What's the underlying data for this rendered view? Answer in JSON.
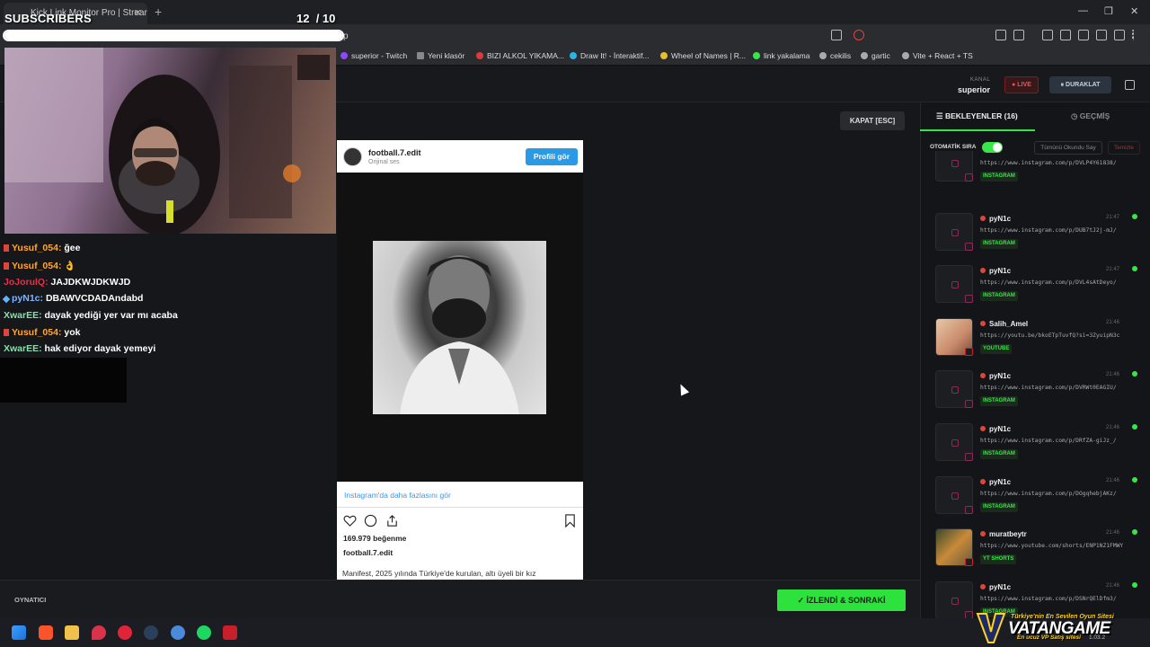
{
  "browser": {
    "tab_title": "Kick Link Monitor Pro | Stream",
    "tab_close": "✕",
    "new_tab": "+",
    "url": "p",
    "window_minimize": "—",
    "window_maximize": "❐",
    "window_close": "✕"
  },
  "bookmarks": [
    {
      "label": "superior - Twitch",
      "color": "#9146ff"
    },
    {
      "label": "Yeni klasör",
      "color": "#888888"
    },
    {
      "label": "BIZI ALKOL YIKAMA...",
      "color": "#e03b3b"
    },
    {
      "label": "Draw It! - İnteraktif...",
      "color": "#2bb3e6"
    },
    {
      "label": "Wheel of Names | R...",
      "color": "#e6c02b"
    },
    {
      "label": "link yakalama",
      "color": "#39e64a"
    },
    {
      "label": "cekilis",
      "color": "#aaaaaa"
    },
    {
      "label": "gartic",
      "color": "#aaaaaa"
    },
    {
      "label": "Vite + React + TS",
      "color": "#aaaaaa"
    }
  ],
  "overlay": {
    "subs_label": "SUBSCRIBERS",
    "subs_current": "12",
    "subs_goal": "/ 10",
    "subs_progress": 1.0
  },
  "header": {
    "kanal_label": "KANAL",
    "channel": "superior",
    "live": "● LIVE",
    "pause": "⏸ DURAKLAT"
  },
  "chat": [
    {
      "user": "Yusuf_054:",
      "msg": "ğee",
      "color": "#ffa733",
      "badge": "#e0443a"
    },
    {
      "user": "Yusuf_054:",
      "msg": "👌",
      "color": "#ffa733",
      "badge": "#e0443a"
    },
    {
      "user": "JoJorulQ:",
      "msg": "JAJDKWJDKWJD",
      "color": "#e0334a",
      "badge": ""
    },
    {
      "user": "pyN1c:",
      "msg": "DBAWVCDADAndabd",
      "color": "#7fb6ff",
      "badge": "#5fb6ff"
    },
    {
      "user": "XwarEE:",
      "msg": "dayak yediği yer var mı acaba",
      "color": "#8fdcb0",
      "badge": ""
    },
    {
      "user": "Yusuf_054:",
      "msg": "yok",
      "color": "#ffa733",
      "badge": "#e0443a"
    },
    {
      "user": "XwarEE:",
      "msg": "hak ediyor dayak yemeyi",
      "color": "#8fdcb0",
      "badge": ""
    }
  ],
  "blackbox_text": "",
  "center": {
    "close_button": "KAPAT [ESC]"
  },
  "instagram": {
    "username": "football.7.edit",
    "subtitle": "Orijinal ses",
    "profile_button": "Profili gör",
    "more_link": "Instagram'da daha fazlasını gör",
    "likes": "169.979 beğenme",
    "owner": "football.7.edit",
    "caption": "Manifest, 2025 yılında Türkiye'de kurulan, altı üyeli bir kız"
  },
  "queue_panel": {
    "tab_queue": "BEKLEYENLER (16)",
    "tab_history": "GEÇMİŞ",
    "auto_label": "OTOMATİK SIRA",
    "auto_on": true,
    "mark_all": "Tümünü Okundu Say",
    "clear": "Temizle",
    "items": [
      {
        "user": "",
        "time": "",
        "url": "https://www.instagram.com/p/DVLP4Y61838/",
        "tag": "INSTAGRAM",
        "thumb": "",
        "dot": false
      },
      {
        "user": "pyN1c",
        "time": "21:47",
        "url": "https://www.instagram.com/p/DUB7tJ2j-mJ/",
        "tag": "INSTAGRAM",
        "thumb": "",
        "dot": true
      },
      {
        "user": "pyN1c",
        "time": "21:47",
        "url": "https://www.instagram.com/p/DVL4sAtDeyo/",
        "tag": "INSTAGRAM",
        "thumb": "",
        "dot": true
      },
      {
        "user": "Salih_Amel",
        "time": "21:46",
        "url": "https://youtu.be/bkoETpTuvfQ?si=3ZyuipN3c",
        "tag": "YOUTUBE",
        "thumb": "img1",
        "dot": false
      },
      {
        "user": "pyN1c",
        "time": "21:46",
        "url": "https://www.instagram.com/p/DVRWt0EAGIU/",
        "tag": "INSTAGRAM",
        "thumb": "",
        "dot": true
      },
      {
        "user": "pyN1c",
        "time": "21:46",
        "url": "https://www.instagram.com/p/DRfZA-giJz_/",
        "tag": "INSTAGRAM",
        "thumb": "",
        "dot": true
      },
      {
        "user": "pyN1c",
        "time": "21:46",
        "url": "https://www.instagram.com/p/DOgqhebjAKz/",
        "tag": "INSTAGRAM",
        "thumb": "",
        "dot": true
      },
      {
        "user": "muratbeytr",
        "time": "21:46",
        "url": "https://www.youtube.com/shorts/ENP1NZ1FMWY",
        "tag": "YT SHORTS",
        "thumb": "img2",
        "dot": true
      },
      {
        "user": "pyN1c",
        "time": "21:46",
        "url": "https://www.instagram.com/p/DSNrQElDfm3/",
        "tag": "INSTAGRAM",
        "thumb": "",
        "dot": true
      }
    ]
  },
  "bottom": {
    "player_label": "OYNATICI",
    "next_button": "✓ İZLENDİ & SONRAKİ"
  },
  "watermark": {
    "top": "Türkiye'nin En Sevilen Oyun Sitesi",
    "title": "VATANGAME",
    "sub": "En ucuz VP Satış sitesi",
    "clock": "1.03.2"
  }
}
